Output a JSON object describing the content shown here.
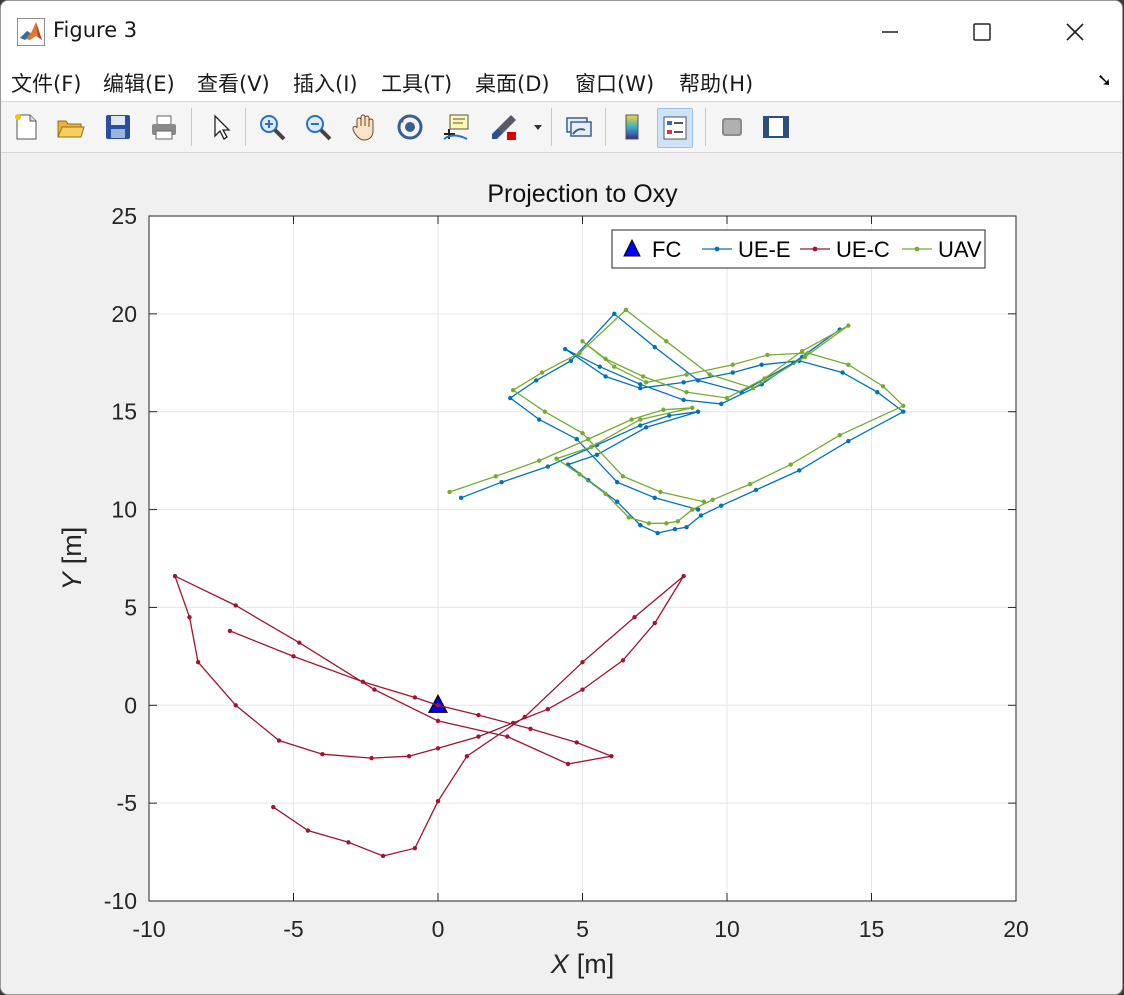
{
  "window": {
    "title": "Figure 3"
  },
  "menu": [
    "文件(F)",
    "编辑(E)",
    "查看(V)",
    "插入(I)",
    "工具(T)",
    "桌面(D)",
    "窗口(W)",
    "帮助(H)"
  ],
  "toolbar": {
    "icons": [
      "new-figure-icon",
      "open-file-icon",
      "save-icon",
      "print-icon",
      "pointer-icon",
      "zoom-in-icon",
      "zoom-out-icon",
      "pan-icon",
      "rotate-3d-icon",
      "data-cursor-icon",
      "brush-icon",
      "link-plot-icon",
      "colorbar-icon",
      "legend-icon",
      "hide-plot-tools-icon",
      "show-plot-tools-icon"
    ],
    "active": "legend-icon"
  },
  "chart_data": {
    "type": "line",
    "title": "Projection to Oxy",
    "xlabel": "X",
    "xunit": "[m]",
    "ylabel": "Y",
    "yunit": "[m]",
    "xlim": [
      -10,
      20
    ],
    "ylim": [
      -10,
      25
    ],
    "xticks": [
      "-10",
      "-5",
      "0",
      "5",
      "10",
      "15",
      "20"
    ],
    "yticks": [
      "-10",
      "-5",
      "0",
      "5",
      "10",
      "15",
      "20",
      "25"
    ],
    "grid": true,
    "legend_position": "top-right",
    "series": [
      {
        "name": "FC",
        "marker": "triangle",
        "color": "#0000ff",
        "x": [
          0
        ],
        "y": [
          0
        ]
      },
      {
        "name": "UE-E",
        "marker": "dot",
        "color": "#0072bd",
        "x": [
          0.8,
          2.2,
          3.8,
          5.5,
          7.0,
          8.0,
          9.0,
          7.2,
          5.5,
          4.5,
          5.2,
          6.2,
          7.0,
          7.6,
          8.2,
          8.6,
          9.1,
          9.8,
          11.0,
          12.5,
          14.2,
          16.1,
          15.2,
          14.0,
          12.5,
          11.2,
          10.2,
          8.5,
          7.0,
          5.8,
          4.4,
          5.6,
          7.0,
          8.5,
          9.8,
          11.2,
          12.6,
          13.9,
          12.3,
          10.5,
          9.0,
          7.5,
          6.1,
          4.6,
          3.4,
          2.5,
          3.5,
          4.8,
          6.2,
          7.5,
          9.0
        ],
        "y": [
          10.6,
          11.4,
          12.2,
          13.3,
          14.3,
          14.8,
          15.0,
          14.2,
          12.8,
          12.3,
          11.5,
          10.4,
          9.2,
          8.8,
          9.0,
          9.1,
          9.7,
          10.2,
          11.0,
          12.0,
          13.5,
          15.0,
          16.0,
          17.0,
          17.6,
          17.4,
          17.0,
          16.5,
          16.2,
          16.8,
          18.2,
          17.3,
          16.4,
          15.6,
          15.4,
          16.4,
          17.8,
          19.2,
          17.5,
          16.0,
          16.6,
          18.3,
          20.0,
          17.6,
          16.6,
          15.7,
          14.6,
          13.6,
          11.4,
          10.6,
          10.0
        ]
      },
      {
        "name": "UE-C",
        "marker": "dot",
        "color": "#a2142f",
        "x": [
          -7.2,
          -5.0,
          -2.6,
          -0.8,
          0.0,
          1.4,
          3.2,
          4.8,
          6.0,
          4.5,
          2.4,
          0.0,
          -2.2,
          -4.8,
          -7.0,
          -9.1,
          -8.6,
          -8.3,
          -7.0,
          -5.5,
          -4.0,
          -2.3,
          -1.0,
          0.0,
          1.4,
          2.6,
          3.8,
          5.0,
          6.4,
          7.5,
          8.5,
          6.8,
          5.0,
          3.0,
          1.0,
          0.0,
          -0.8,
          -1.9,
          -3.1,
          -4.5,
          -5.7
        ],
        "y": [
          3.8,
          2.5,
          1.2,
          0.4,
          0.0,
          -0.5,
          -1.2,
          -1.9,
          -2.6,
          -3.0,
          -1.6,
          -0.8,
          0.8,
          3.2,
          5.1,
          6.6,
          4.5,
          2.2,
          0.0,
          -1.8,
          -2.5,
          -2.7,
          -2.6,
          -2.2,
          -1.6,
          -0.9,
          -0.2,
          0.8,
          2.3,
          4.2,
          6.6,
          4.5,
          2.2,
          -0.6,
          -2.6,
          -4.9,
          -7.3,
          -7.7,
          -7.0,
          -6.4,
          -5.2
        ]
      },
      {
        "name": "UAV",
        "marker": "dot",
        "color": "#77ac30",
        "x": [
          0.4,
          2.0,
          3.5,
          5.2,
          6.7,
          7.8,
          8.8,
          7.0,
          5.3,
          4.1,
          4.9,
          5.8,
          6.6,
          7.3,
          7.9,
          8.3,
          8.8,
          9.5,
          10.8,
          12.2,
          13.9,
          16.1,
          15.4,
          14.2,
          12.8,
          11.4,
          10.2,
          8.6,
          7.2,
          6.1,
          5.0,
          5.8,
          7.1,
          8.6,
          10.0,
          11.3,
          12.6,
          14.2,
          12.7,
          10.9,
          9.4,
          7.9,
          6.5,
          4.9,
          3.6,
          2.6,
          3.7,
          5.0,
          6.4,
          7.7,
          9.2
        ],
        "y": [
          10.9,
          11.7,
          12.5,
          13.6,
          14.6,
          15.1,
          15.2,
          14.6,
          13.2,
          12.6,
          11.8,
          10.8,
          9.6,
          9.3,
          9.3,
          9.4,
          10.0,
          10.5,
          11.3,
          12.3,
          13.8,
          15.3,
          16.3,
          17.4,
          18.0,
          17.9,
          17.4,
          16.9,
          16.5,
          17.3,
          18.6,
          17.7,
          16.8,
          16.0,
          15.7,
          16.7,
          18.1,
          19.4,
          17.8,
          16.2,
          16.9,
          18.6,
          20.2,
          18.0,
          17.0,
          16.1,
          15.0,
          13.9,
          11.7,
          10.9,
          10.4
        ]
      }
    ]
  },
  "colors": {
    "window_bg": "#f0f0f0",
    "axes_bg": "#ffffff",
    "grid": "#e6e6e6"
  }
}
